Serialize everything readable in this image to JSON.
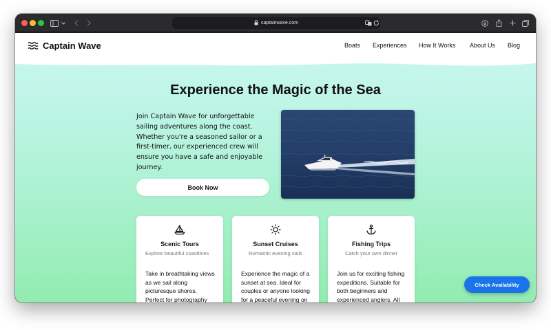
{
  "browser": {
    "url": "captainwave.com"
  },
  "header": {
    "logo_text": "Captain Wave",
    "nav": [
      "Boats",
      "Experiences",
      "How It Works",
      "About Us",
      "Blog"
    ]
  },
  "hero": {
    "title": "Experience the Magic of the Sea",
    "intro": "Join Captain Wave for unforgettable sailing adventures along the coast. Whether you're a seasoned sailor or a first-timer, our experienced crew will ensure you have a safe and enjoyable journey.",
    "book_button": "Book Now"
  },
  "cards": [
    {
      "icon": "sailboat-icon",
      "title": "Scenic Tours",
      "subtitle": "Explore beautiful coastlines",
      "body": "Take in breathtaking views as we sail along picturesque shores. Perfect for photography"
    },
    {
      "icon": "sun-icon",
      "title": "Sunset Cruises",
      "subtitle": "Romantic evening sails",
      "body": "Experience the magic of a sunset at sea. Ideal for couples or anyone looking for a peaceful evening on the water."
    },
    {
      "icon": "anchor-icon",
      "title": "Fishing Trips",
      "subtitle": "Catch your own dinner",
      "body": "Join us for exciting fishing expeditions. Suitable for both beginners and experienced anglers. All equipment"
    }
  ],
  "floating_button": "Check Availability",
  "colors": {
    "page_gradient_top": "#ccf7f3",
    "page_gradient_bottom": "#92ecb0",
    "check_button": "#1a73e8"
  }
}
